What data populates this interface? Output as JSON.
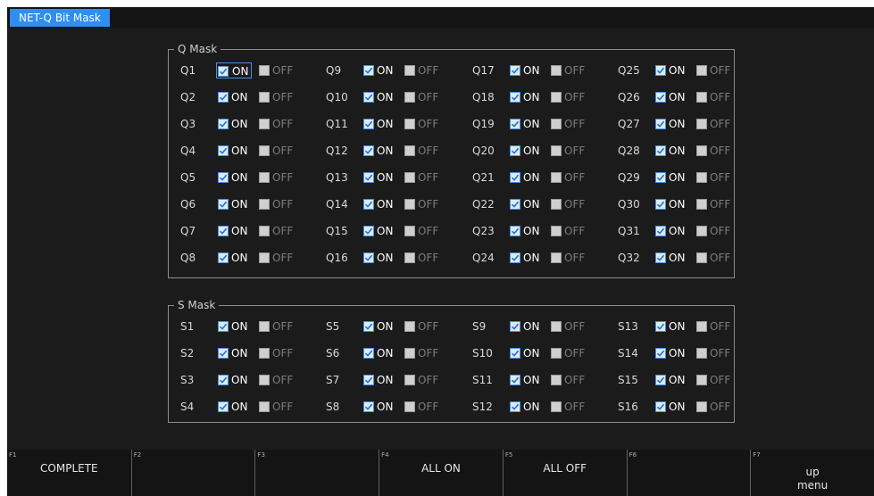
{
  "window": {
    "tab_title": "NET-Q Bit Mask"
  },
  "colors": {
    "tab": "#2f8ef0",
    "screen_bg": "#1b1b1b",
    "check_border": "#4a90e2"
  },
  "options": {
    "on_label": "ON",
    "off_label": "OFF"
  },
  "q_mask": {
    "title": "Q Mask",
    "labels": [
      "Q1",
      "Q9",
      "Q17",
      "Q25",
      "Q2",
      "Q10",
      "Q18",
      "Q26",
      "Q3",
      "Q11",
      "Q19",
      "Q27",
      "Q4",
      "Q12",
      "Q20",
      "Q28",
      "Q5",
      "Q13",
      "Q21",
      "Q29",
      "Q6",
      "Q14",
      "Q22",
      "Q30",
      "Q7",
      "Q15",
      "Q23",
      "Q31",
      "Q8",
      "Q16",
      "Q24",
      "Q32"
    ],
    "selected": "ON",
    "focused": "Q1"
  },
  "s_mask": {
    "title": "S Mask",
    "labels": [
      "S1",
      "S5",
      "S9",
      "S13",
      "S2",
      "S6",
      "S10",
      "S14",
      "S3",
      "S7",
      "S11",
      "S15",
      "S4",
      "S8",
      "S12",
      "S16"
    ],
    "selected": "ON"
  },
  "function_keys": [
    {
      "num": "F1",
      "label": "COMPLETE"
    },
    {
      "num": "F2",
      "label": ""
    },
    {
      "num": "F3",
      "label": ""
    },
    {
      "num": "F4",
      "label": "ALL ON"
    },
    {
      "num": "F5",
      "label": "ALL OFF"
    },
    {
      "num": "F6",
      "label": ""
    },
    {
      "num": "F7",
      "label": "up\nmenu"
    }
  ]
}
